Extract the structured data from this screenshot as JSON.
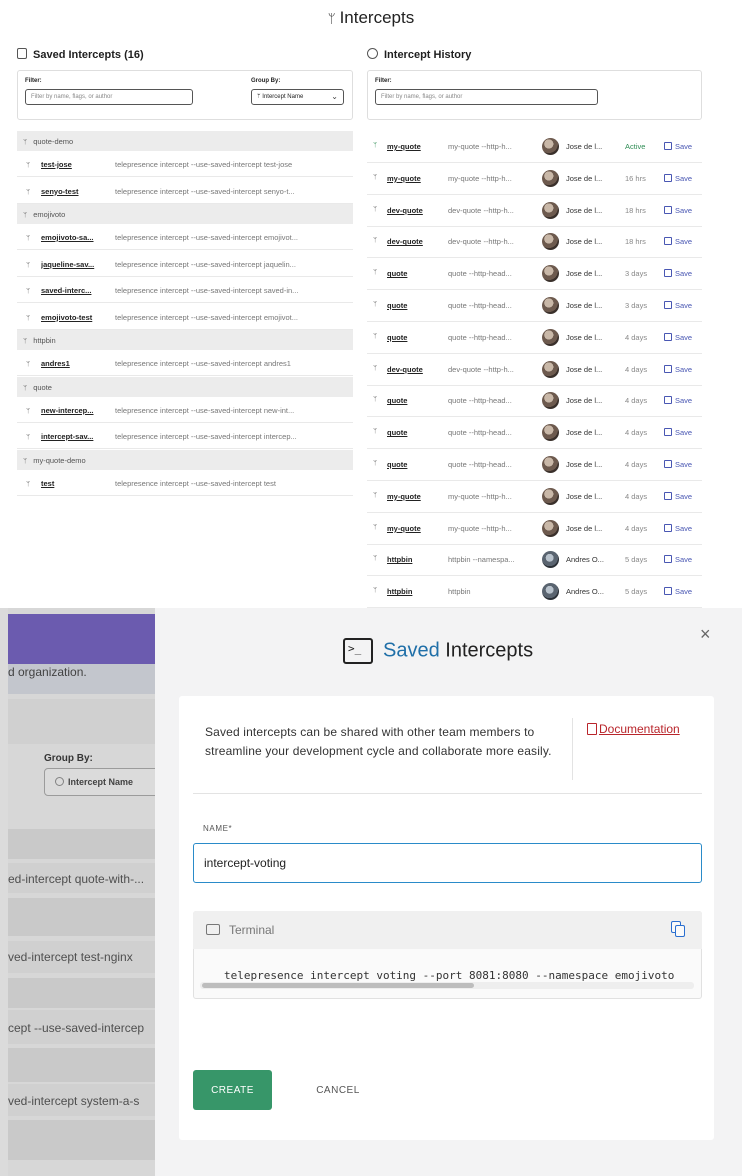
{
  "page": {
    "title": "Intercepts"
  },
  "saved": {
    "title": "Saved Intercepts (16)",
    "filter_label": "Filter:",
    "filter_placeholder": "Filter by name, flags, or author",
    "group_label": "Group By:",
    "group_value": "Intercept Name",
    "rows": [
      {
        "kind": "group",
        "name": "quote-demo"
      },
      {
        "kind": "item",
        "name": "test-jose",
        "cmd": "telepresence intercept --use-saved-intercept test-jose"
      },
      {
        "kind": "item",
        "name": "senyo-test",
        "cmd": "telepresence intercept --use-saved-intercept senyo-t..."
      },
      {
        "kind": "group",
        "name": "emojivoto"
      },
      {
        "kind": "item",
        "name": "emojivoto-sa...",
        "cmd": "telepresence intercept --use-saved-intercept emojivot..."
      },
      {
        "kind": "item",
        "name": "jaqueline-sav...",
        "cmd": "telepresence intercept --use-saved-intercept jaquelin..."
      },
      {
        "kind": "item",
        "name": "saved-interc...",
        "cmd": "telepresence intercept --use-saved-intercept saved-in..."
      },
      {
        "kind": "item",
        "name": "emojivoto-test",
        "cmd": "telepresence intercept --use-saved-intercept emojivot..."
      },
      {
        "kind": "group",
        "name": "httpbin"
      },
      {
        "kind": "item",
        "name": "andres1",
        "cmd": "telepresence intercept --use-saved-intercept andres1"
      },
      {
        "kind": "group",
        "name": "quote"
      },
      {
        "kind": "item",
        "name": "new-intercep...",
        "cmd": "telepresence intercept --use-saved-intercept new-int..."
      },
      {
        "kind": "item",
        "name": "intercept-sav...",
        "cmd": "telepresence intercept --use-saved-intercept intercep..."
      },
      {
        "kind": "group",
        "name": "my-quote-demo"
      },
      {
        "kind": "item",
        "name": "test",
        "cmd": "telepresence intercept --use-saved-intercept test"
      }
    ]
  },
  "history": {
    "title": "Intercept History",
    "filter_label": "Filter:",
    "filter_placeholder": "Filter by name, flags, or author",
    "save_label": "Save",
    "rows": [
      {
        "name": "my-quote",
        "cmd": "my-quote --http-h...",
        "author": "Jose de l...",
        "time": "Active",
        "active": true
      },
      {
        "name": "my-quote",
        "cmd": "my-quote --http-h...",
        "author": "Jose de l...",
        "time": "16 hrs"
      },
      {
        "name": "dev-quote",
        "cmd": "dev-quote --http-h...",
        "author": "Jose de l...",
        "time": "18 hrs"
      },
      {
        "name": "dev-quote",
        "cmd": "dev-quote --http-h...",
        "author": "Jose de l...",
        "time": "18 hrs"
      },
      {
        "name": "quote",
        "cmd": "quote --http-head...",
        "author": "Jose de l...",
        "time": "3 days"
      },
      {
        "name": "quote",
        "cmd": "quote --http-head...",
        "author": "Jose de l...",
        "time": "3 days"
      },
      {
        "name": "quote",
        "cmd": "quote --http-head...",
        "author": "Jose de l...",
        "time": "4 days"
      },
      {
        "name": "dev-quote",
        "cmd": "dev-quote --http-h...",
        "author": "Jose de l...",
        "time": "4 days"
      },
      {
        "name": "quote",
        "cmd": "quote --http-head...",
        "author": "Jose de l...",
        "time": "4 days"
      },
      {
        "name": "quote",
        "cmd": "quote --http-head...",
        "author": "Jose de l...",
        "time": "4 days"
      },
      {
        "name": "quote",
        "cmd": "quote --http-head...",
        "author": "Jose de l...",
        "time": "4 days"
      },
      {
        "name": "my-quote",
        "cmd": "my-quote --http-h...",
        "author": "Jose de l...",
        "time": "4 days"
      },
      {
        "name": "my-quote",
        "cmd": "my-quote --http-h...",
        "author": "Jose de l...",
        "time": "4 days"
      },
      {
        "name": "httpbin",
        "cmd": "httpbin --namespa...",
        "author": "Andres O...",
        "time": "5 days",
        "alt": true
      },
      {
        "name": "httpbin",
        "cmd": "httpbin",
        "author": "Andres O...",
        "time": "5 days",
        "alt": true
      }
    ]
  },
  "background": {
    "org_text": "d organization.",
    "group_label": "Group By:",
    "group_value": "Intercept Name",
    "cmd_fragments": [
      "ed-intercept quote-with-...",
      "ved-intercept test-nginx",
      "cept --use-saved-intercep",
      "ved-intercept system-a-s"
    ]
  },
  "modal": {
    "title_accent": "Saved",
    "title_rest": " Intercepts",
    "close_glyph": "×",
    "description": "Saved intercepts can be shared with other team members to streamline your development cycle and collaborate more easily.",
    "doc_link": "Documentation",
    "name_label": "NAME*",
    "name_value": "intercept-voting",
    "terminal_title": "Terminal",
    "command": "telepresence intercept voting --port 8081:8080 --namespace emojivoto",
    "create_label": "CREATE",
    "cancel_label": "CANCEL"
  },
  "colors": {
    "accent_blue": "#1f6fa8",
    "create_green": "#379669",
    "link_red": "#b9252b",
    "active_green": "#2f8d55",
    "save_blue": "#4957b3",
    "header_purple": "#6a55c4"
  },
  "icons": {
    "branch": "branch-icon",
    "saved": "saved-list-icon",
    "history": "clock-icon",
    "terminal": "terminal-icon",
    "copy": "copy-icon",
    "doc": "document-icon",
    "close": "close-icon",
    "save": "save-icon"
  }
}
